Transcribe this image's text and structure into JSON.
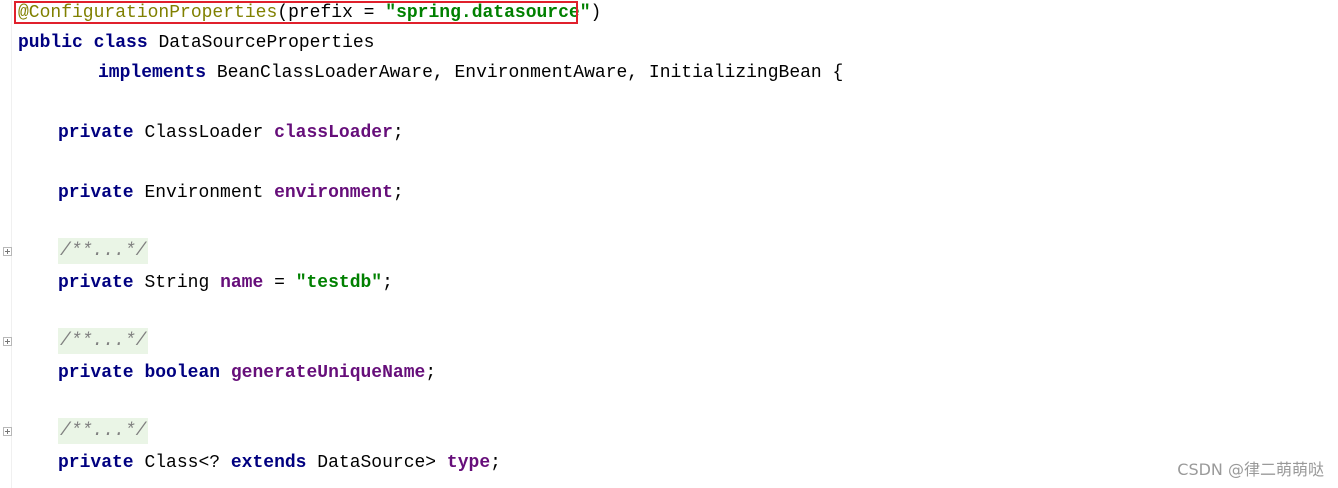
{
  "editor": {
    "annotation": {
      "name": "@ConfigurationProperties",
      "open_paren": "(",
      "param": "prefix",
      "equals": " = ",
      "value": "\"spring.datasource\"",
      "close_paren": ")"
    },
    "class_decl": {
      "kw_public": "public",
      "kw_class": "class",
      "class_name": "DataSourceProperties"
    },
    "implements_line": {
      "kw_implements": "implements",
      "interfaces": " BeanClassLoaderAware, EnvironmentAware, InitializingBean {"
    },
    "fields": [
      {
        "kw": "private",
        "type": "ClassLoader",
        "name": "classLoader",
        "tail": ";"
      },
      {
        "kw": "private",
        "type": "Environment",
        "name": "environment",
        "tail": ";"
      },
      {
        "folded_comment": "/**...*/",
        "kw": "private",
        "type": "String",
        "name": "name",
        "assign": " = ",
        "value": "\"testdb\"",
        "tail": ";"
      },
      {
        "folded_comment": "/**...*/",
        "kw": "private",
        "type_kw": "boolean",
        "name": "generateUniqueName",
        "tail": ";"
      },
      {
        "folded_comment": "/**...*/",
        "kw": "private",
        "type_prefix": "Class<? ",
        "type_kw": "extends",
        "type_suffix": " DataSource> ",
        "name": "type",
        "tail": ";"
      }
    ]
  },
  "watermark": "CSDN @律二萌萌哒"
}
